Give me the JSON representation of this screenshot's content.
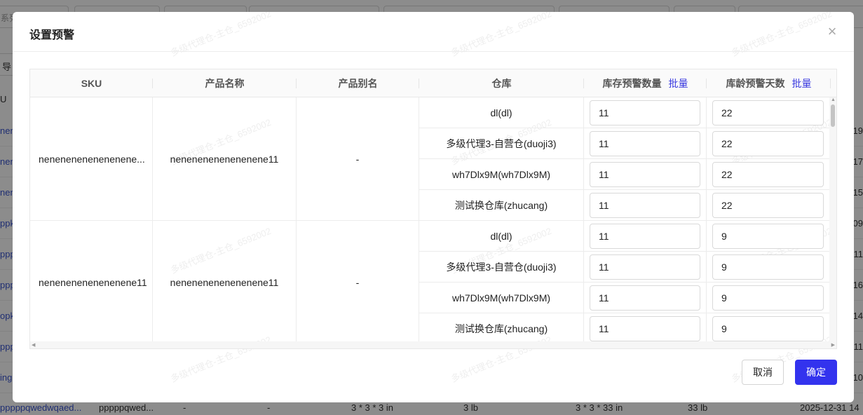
{
  "background": {
    "filter_placeholder": "系列",
    "toolbar_btn": "导",
    "header_text": "U",
    "rows": [
      {
        "left": "nene",
        "right": "19"
      },
      {
        "left": "nene",
        "right": "17"
      },
      {
        "left": "nene",
        "right": "15"
      },
      {
        "left": "ppk",
        "right": "09"
      },
      {
        "left": "ppp",
        "right": "11"
      },
      {
        "left": "ppp",
        "right": "16"
      },
      {
        "left": "opk",
        "right": "14"
      },
      {
        "left": "ppp",
        "right": "11"
      },
      {
        "left": "ing",
        "right": "10"
      }
    ],
    "bottom": {
      "sku": "pppppqwedwqaed...",
      "name": "pppppqwed...",
      "dash1": "-",
      "dash2": "-",
      "size": "3 * 3 * 3 in",
      "weight": "3 lb",
      "size2": "3 * 3 * 33 in",
      "weight2": "33 lb",
      "date": "2025-12-31 14"
    }
  },
  "modal": {
    "title": "设置预警",
    "close_icon": "×",
    "columns": {
      "sku": "SKU",
      "product_name": "产品名称",
      "product_alias": "产品别名",
      "warehouse": "仓库",
      "stock_warning_qty": "库存预警数量",
      "age_warning_days": "库龄预警天数",
      "batch": "批量"
    },
    "groups": [
      {
        "sku": "nenenenenenenenene...",
        "product_name": "nenenenenenenenene11",
        "alias": "-",
        "rows": [
          {
            "warehouse": "dl(dl)",
            "qty": "11",
            "days": "22"
          },
          {
            "warehouse": "多级代理3-自营仓(duoji3)",
            "qty": "11",
            "days": "22"
          },
          {
            "warehouse": "wh7Dlx9M(wh7Dlx9M)",
            "qty": "11",
            "days": "22"
          },
          {
            "warehouse": "测试换仓库(zhucang)",
            "qty": "11",
            "days": "22"
          }
        ]
      },
      {
        "sku": "nenenenenenenenene11",
        "product_name": "nenenenenenenenene11",
        "alias": "-",
        "rows": [
          {
            "warehouse": "dl(dl)",
            "qty": "11",
            "days": "9"
          },
          {
            "warehouse": "多级代理3-自营仓(duoji3)",
            "qty": "11",
            "days": "9"
          },
          {
            "warehouse": "wh7Dlx9M(wh7Dlx9M)",
            "qty": "11",
            "days": "9"
          },
          {
            "warehouse": "测试换仓库(zhucang)",
            "qty": "11",
            "days": "9"
          }
        ]
      }
    ],
    "watermark": "多级代理仓-主仓_6592002",
    "footer": {
      "cancel": "取消",
      "confirm": "确定"
    }
  }
}
